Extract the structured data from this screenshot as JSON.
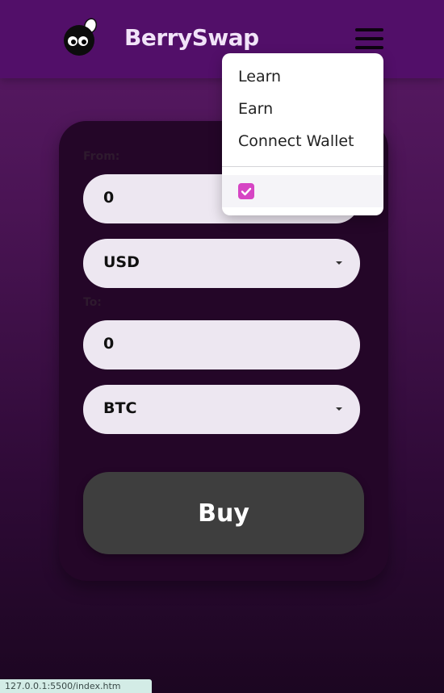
{
  "header": {
    "brand": "BerrySwap",
    "menu_icon": "hamburger-menu-icon",
    "logo_icon": "berry-logo-icon"
  },
  "menu": {
    "items": [
      "Learn",
      "Earn",
      "Connect Wallet"
    ],
    "toggle_checked": true,
    "checkbox_color": "#d645c4"
  },
  "form": {
    "from_label": "From:",
    "from_amount": "0",
    "from_currency": "USD",
    "to_label": "To:",
    "to_amount": "0",
    "to_currency": "BTC",
    "buy_label": "Buy"
  },
  "status_bar": {
    "url": "127.0.0.1:5500/index.htm"
  },
  "colors": {
    "navbar": "#520f69",
    "card": "#240628",
    "field": "#ede7f1",
    "button": "#3e3e3e"
  }
}
